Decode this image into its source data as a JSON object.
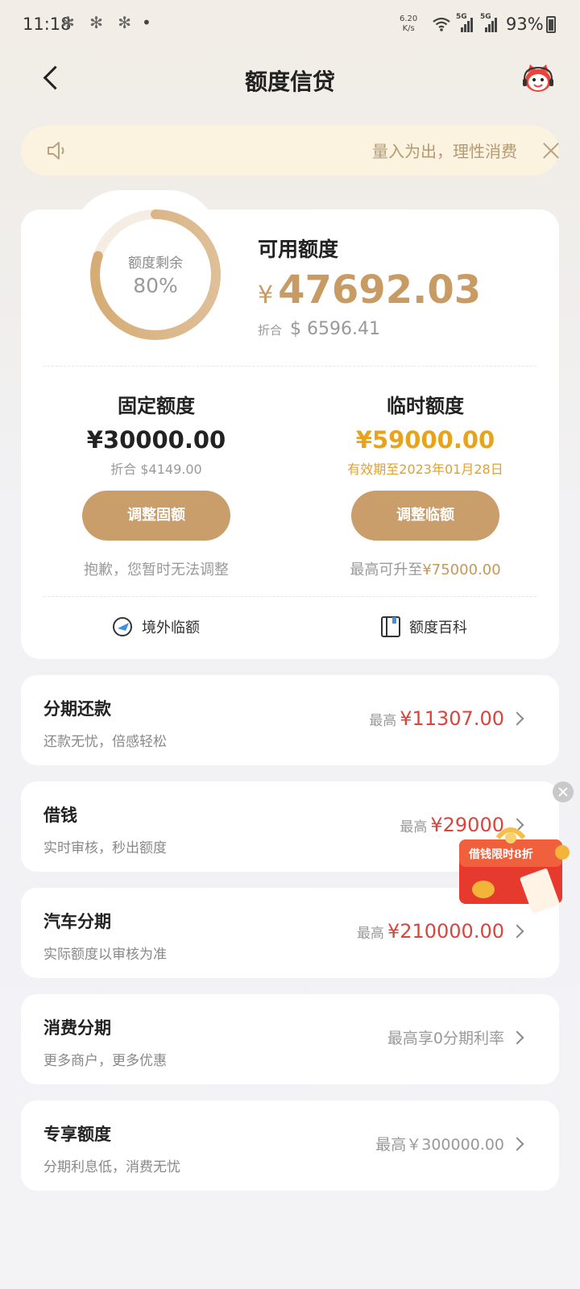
{
  "status_bar": {
    "time": "11:18",
    "notif_icons": "✻ ✻ ✻",
    "dot": "•",
    "net_speed_value": "6.20",
    "net_speed_unit": "K/s",
    "network_label_1": "5G",
    "network_label_2": "5G",
    "battery": "93%"
  },
  "header": {
    "title": "额度信贷"
  },
  "notice": {
    "text": "量入为出，理性消费"
  },
  "available": {
    "ring_label": "额度剩余",
    "ring_value": "80%",
    "ring_fraction": 0.8,
    "title": "可用额度",
    "currency": "¥",
    "amount": "47692.03",
    "usd_label": "折合",
    "usd_amount": "$ 6596.41"
  },
  "fixed": {
    "title": "固定额度",
    "amount": "¥30000.00",
    "usd": "折合 $4149.00",
    "button": "调整固额",
    "note": "抱歉，您暂时无法调整"
  },
  "temp": {
    "title": "临时额度",
    "amount": "¥59000.00",
    "validity": "有效期至2023年01月28日",
    "button": "调整临额",
    "note_prefix": "最高可升至",
    "note_amount": "¥75000.00"
  },
  "links": {
    "overseas": "境外临额",
    "wiki": "额度百科"
  },
  "services": [
    {
      "title": "分期还款",
      "sub": "还款无忧，倍感轻松",
      "prefix": "最高",
      "amount": "¥11307.00"
    },
    {
      "title": "借钱",
      "sub": "实时审核，秒出额度",
      "prefix": "最高",
      "amount": "¥29000"
    },
    {
      "title": "汽车分期",
      "sub": "实际额度以审核为准",
      "prefix": "最高",
      "amount": "¥210000.00"
    },
    {
      "title": "消费分期",
      "sub": "更多商户，更多优惠",
      "prefix": "",
      "amount": "最高享0分期利率"
    },
    {
      "title": "专享额度",
      "sub": "分期利息低，消费无忧",
      "prefix": "",
      "amount": "最高￥300000.00"
    }
  ],
  "promo": {
    "label": "借钱限时8折"
  },
  "colors": {
    "gold": "#c79b63",
    "red": "#d8453d",
    "temp_gold": "#e8a31c"
  }
}
